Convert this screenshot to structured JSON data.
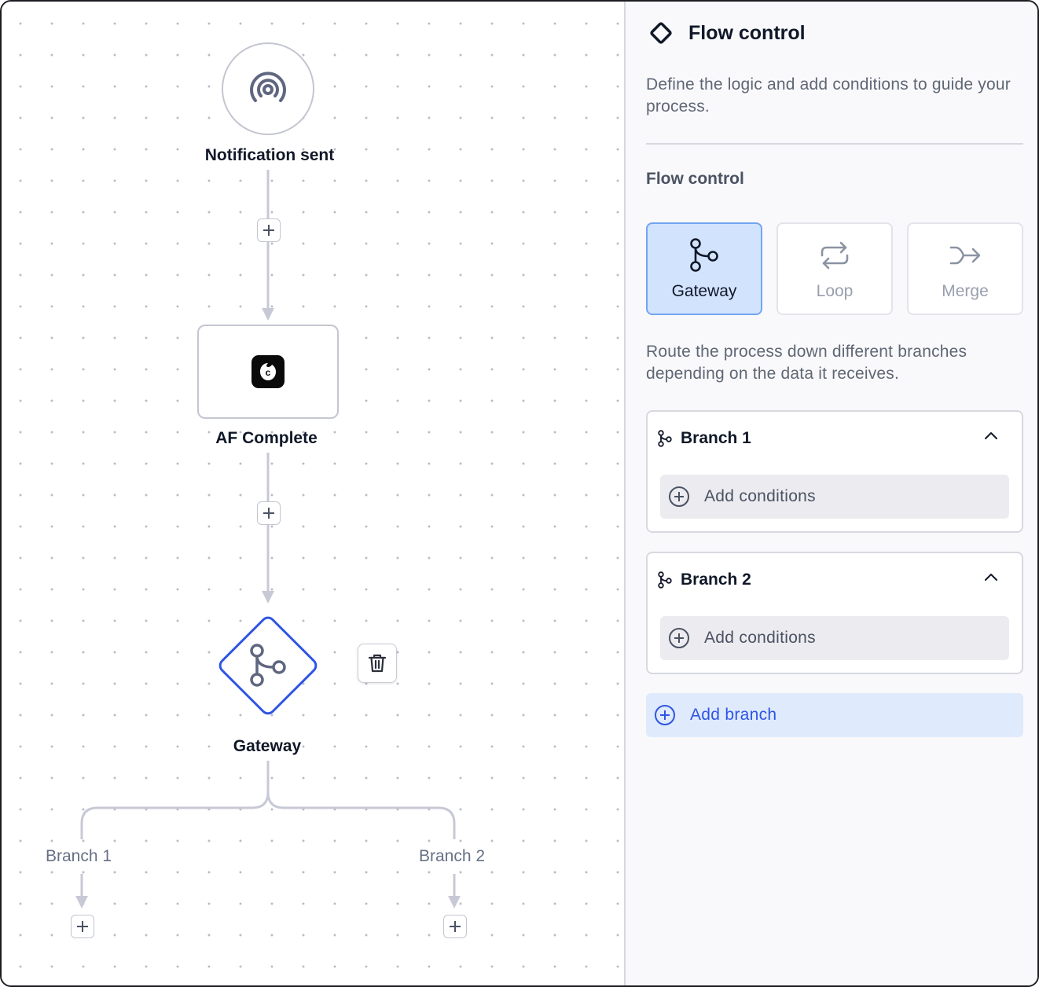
{
  "canvas": {
    "trigger": {
      "label": "Notification sent",
      "icon": "broadcast-icon"
    },
    "app_step": {
      "label": "AF Complete",
      "icon": "app-logo-icon",
      "logo_letter": "c"
    },
    "gateway": {
      "label": "Gateway",
      "icon": "branch-icon"
    },
    "branches": [
      {
        "label": "Branch 1"
      },
      {
        "label": "Branch 2"
      }
    ]
  },
  "panel": {
    "title": "Flow control",
    "description": "Define the logic and add conditions to guide your process.",
    "section_title": "Flow control",
    "types": [
      {
        "label": "Gateway",
        "icon": "branch-icon",
        "selected": true
      },
      {
        "label": "Loop",
        "icon": "loop-icon",
        "selected": false
      },
      {
        "label": "Merge",
        "icon": "merge-icon",
        "selected": false
      }
    ],
    "route_description": "Route the process down different branches depending on the data it receives.",
    "branch_cards": [
      {
        "title": "Branch 1",
        "add_conditions": "Add conditions"
      },
      {
        "title": "Branch 2",
        "add_conditions": "Add conditions"
      }
    ],
    "add_branch": "Add branch"
  },
  "colors": {
    "accent": "#2f55e4",
    "selected_card_bg": "#d2e3fd",
    "wire": "#c8c9d6"
  }
}
